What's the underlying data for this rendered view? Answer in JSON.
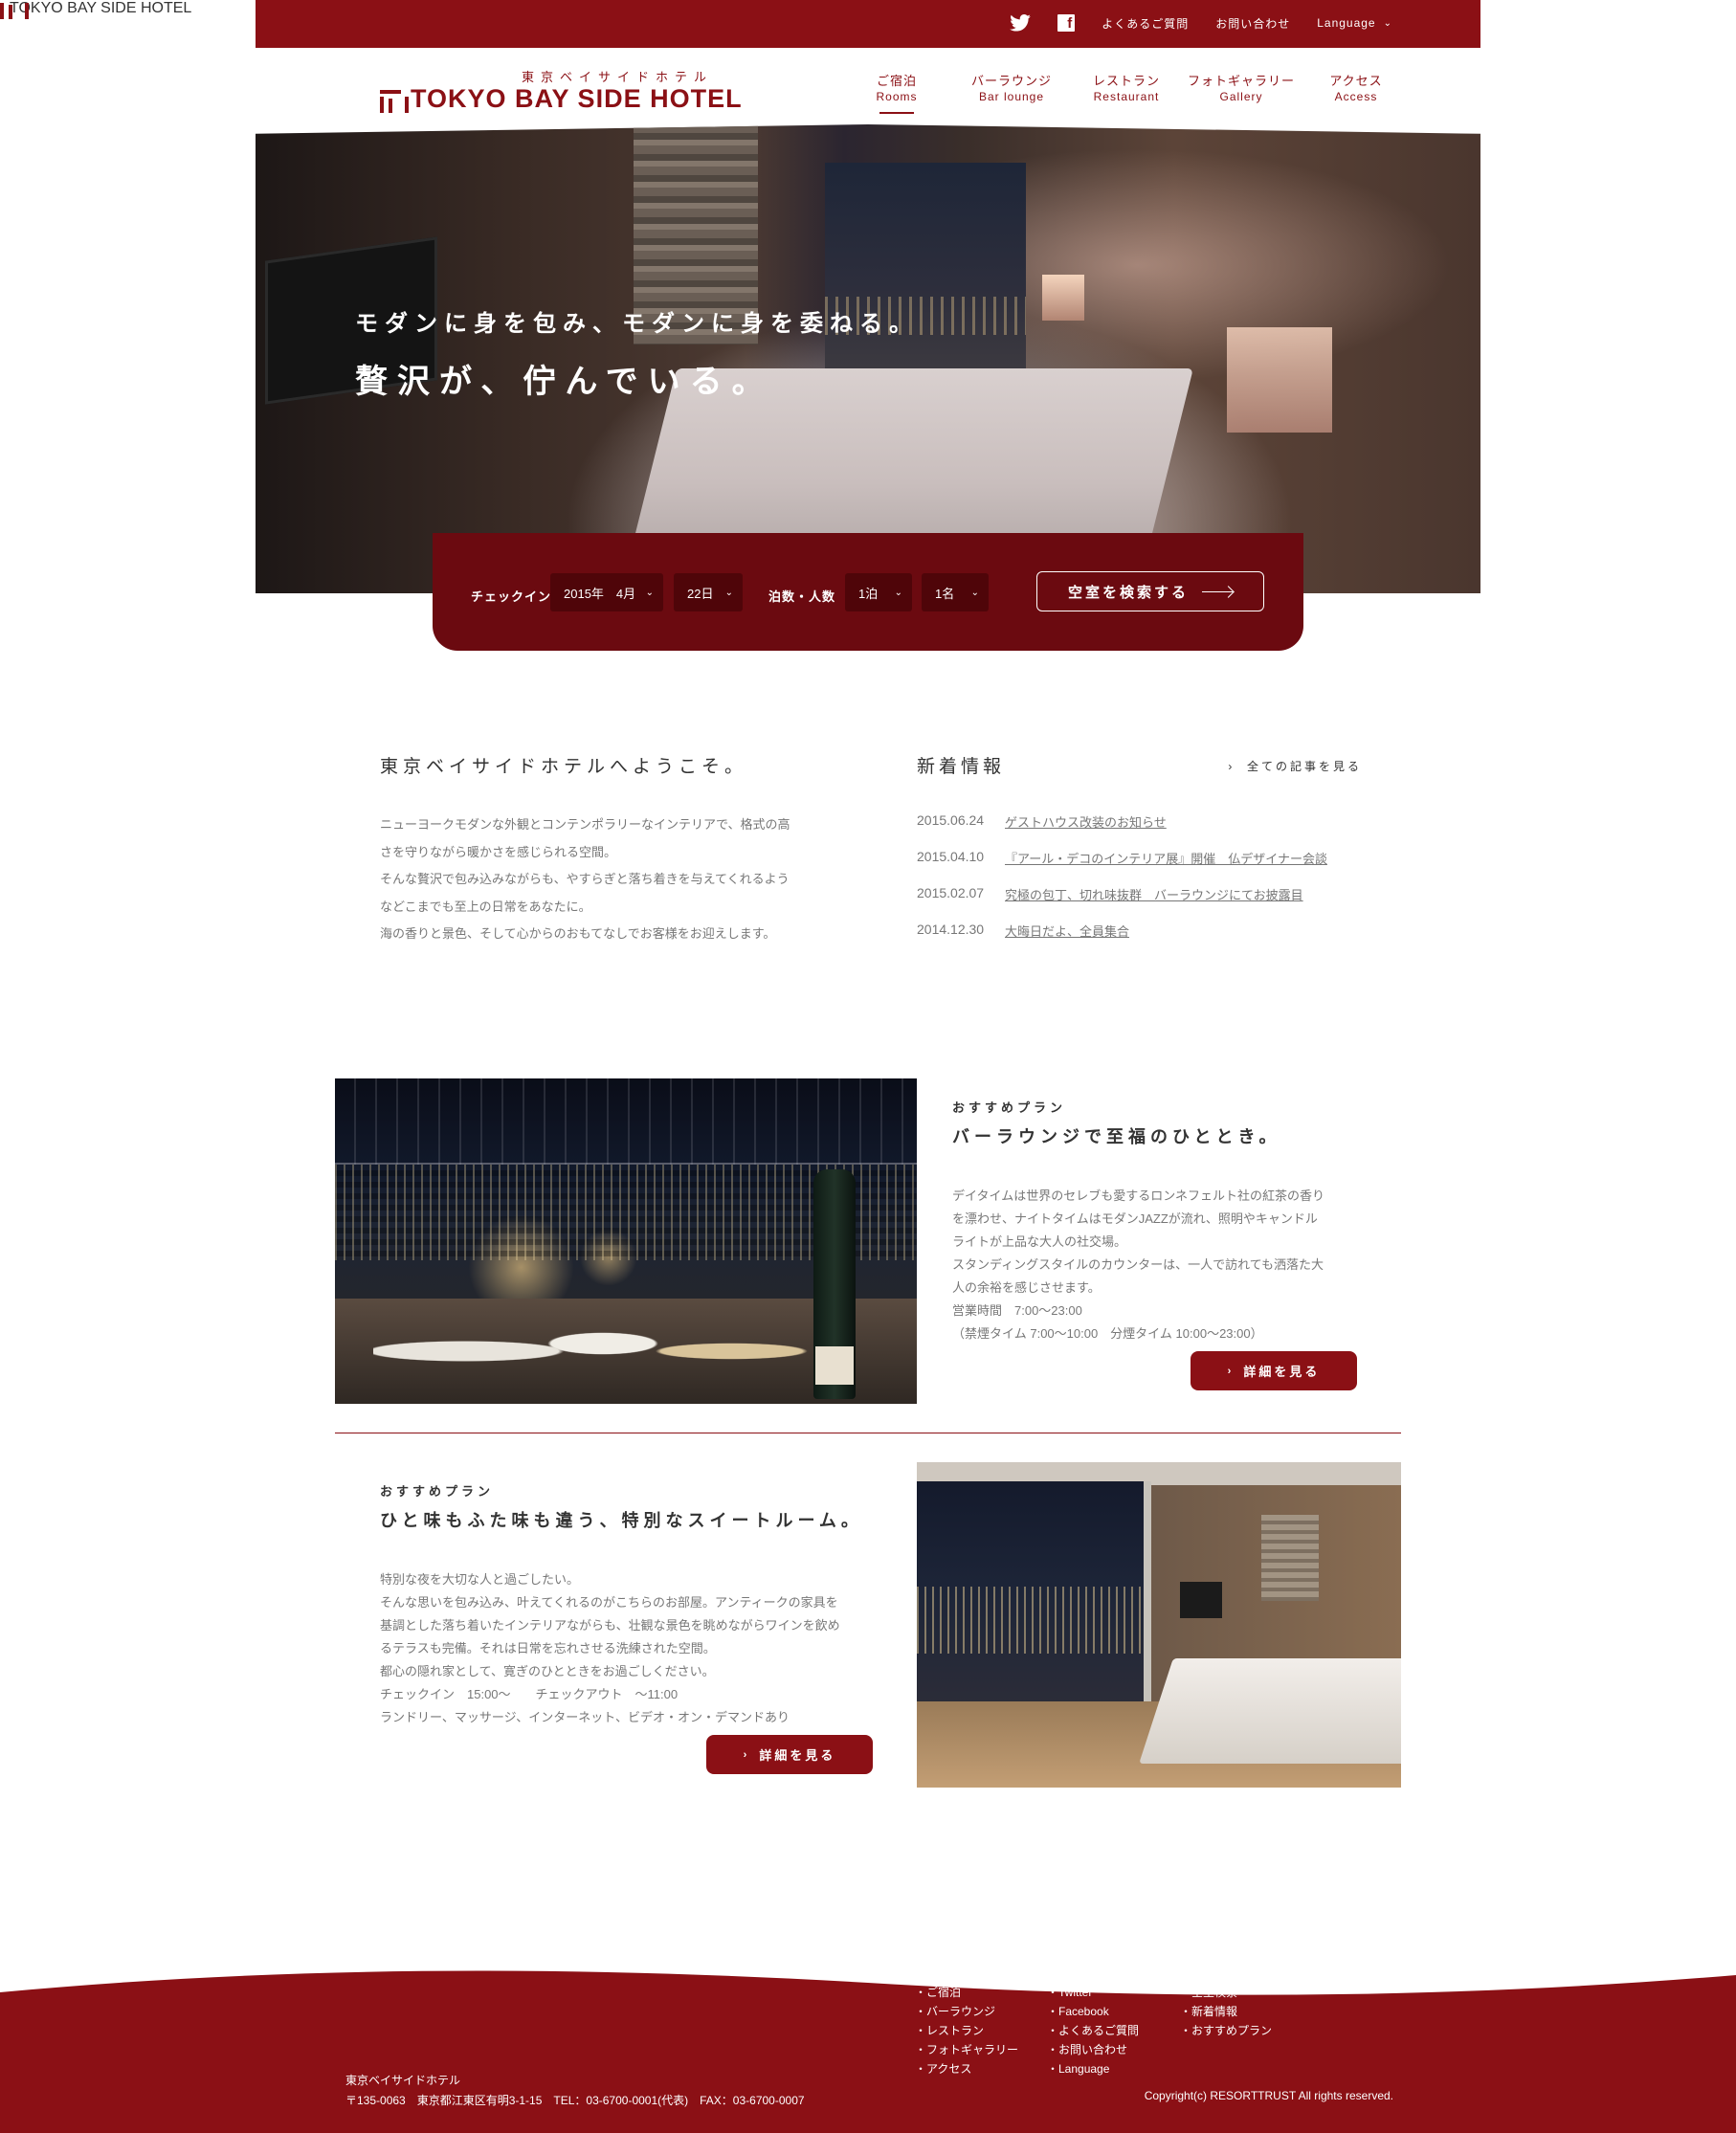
{
  "topbar": {
    "twitter_icon": "twitter-icon",
    "facebook_icon": "facebook-icon",
    "faq": "よくあるご質問",
    "contact": "お問い合わせ",
    "language": "Language"
  },
  "brand": {
    "name_ja": "東京ベイサイドホテル",
    "name_en": "TOKYO BAY SIDE HOTEL",
    "color": "#8b1015",
    "dark_color": "#6b0a10"
  },
  "nav": [
    {
      "ja": "ご宿泊",
      "en": "Rooms",
      "active": true
    },
    {
      "ja": "バーラウンジ",
      "en": "Bar lounge",
      "active": false
    },
    {
      "ja": "レストラン",
      "en": "Restaurant",
      "active": false
    },
    {
      "ja": "フォトギャラリー",
      "en": "Gallery",
      "active": false
    },
    {
      "ja": "アクセス",
      "en": "Access",
      "active": false
    }
  ],
  "hero": {
    "line1": "モダンに身を包み、モダンに身を委ねる。",
    "line2": "贅沢が、佇んでいる。"
  },
  "booking": {
    "checkin_label": "チェックイン",
    "month_value": "2015年　4月",
    "day_value": "22日",
    "stay_label": "泊数・人数",
    "nights_value": "1泊",
    "people_value": "1名",
    "search_label": "空室を検索する"
  },
  "welcome": {
    "title": "東京ベイサイドホテルへようこそ。",
    "lines": [
      "ニューヨークモダンな外観とコンテンポラリーなインテリアで、格式の高",
      "さを守りながら暖かさを感じられる空間。",
      "そんな贅沢で包み込みながらも、やすらぎと落ち着きを与えてくれるよう",
      "などこまでも至上の日常をあなたに。",
      "海の香りと景色、そして心からのおもてなしでお客様をお迎えします。"
    ]
  },
  "news": {
    "title": "新着情報",
    "all_link": "全ての記事を見る",
    "items": [
      {
        "date": "2015.06.24",
        "title": "ゲストハウス改装のお知らせ"
      },
      {
        "date": "2015.04.10",
        "title": "『アール・デコのインテリア展』開催　仏デザイナー会談"
      },
      {
        "date": "2015.02.07",
        "title": "究極の包丁、切れ味抜群　バーラウンジにてお披露目"
      },
      {
        "date": "2014.12.30",
        "title": "大晦日だよ、全員集合"
      }
    ]
  },
  "plan1": {
    "kicker": "おすすめプラン",
    "title": "バーラウンジで至福のひととき。",
    "lines": [
      "デイタイムは世界のセレブも愛するロンネフェルト社の紅茶の香り",
      "を漂わせ、ナイトタイムはモダンJAZZが流れ、照明やキャンドル",
      "ライトが上品な大人の社交場。",
      "スタンディングスタイルのカウンターは、一人で訪れても洒落た大",
      "人の余裕を感じさせます。",
      "営業時間　7:00〜23:00",
      "（禁煙タイム 7:00〜10:00　分煙タイム 10:00〜23:00）"
    ],
    "button": "詳細を見る"
  },
  "plan2": {
    "kicker": "おすすめプラン",
    "title": "ひと味もふた味も違う、特別なスイートルーム。",
    "lines": [
      "特別な夜を大切な人と過ごしたい。",
      "そんな思いを包み込み、叶えてくれるのがこちらのお部屋。アンティークの家具を",
      "基調とした落ち着いたインテリアながらも、壮観な景色を眺めながらワインを飲め",
      "るテラスも完備。それは日常を忘れさせる洗練された空間。",
      "都心の隠れ家として、寛ぎのひとときをお過ごしください。",
      "チェックイン　15:00〜　　チェックアウト　〜11:00",
      "ランドリー、マッサージ、インターネット、ビデオ・オン・デマンドあり"
    ],
    "button": "詳細を見る"
  },
  "footer": {
    "logo": "TOKYO BAY SIDE HOTEL",
    "name": "東京ベイサイドホテル",
    "address": "〒135-0063　東京都江東区有明3-1-15　TEL：03-6700-0001(代表)　FAX：03-6700-0007",
    "col1": [
      "・ご宿泊",
      "・バーラウンジ",
      "・レストラン",
      "・フォトギャラリー",
      "・アクセス"
    ],
    "col2": [
      "・Twitter",
      "・Facebook",
      "・よくあるご質問",
      "・お問い合わせ",
      "・Language"
    ],
    "col3": [
      "・空室検索",
      "・新着情報",
      "・おすすめプラン"
    ],
    "copyright": "Copyright(c) RESORTTRUST All rights reserved."
  }
}
